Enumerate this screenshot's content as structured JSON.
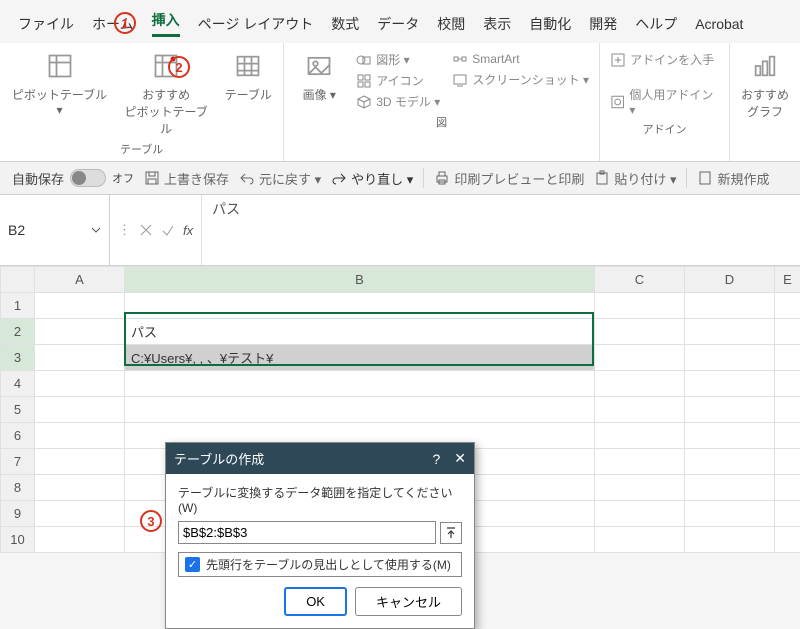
{
  "tabs": {
    "file": "ファイル",
    "home": "ホーム",
    "insert": "挿入",
    "page_layout": "ページ レイアウト",
    "formulas": "数式",
    "data": "データ",
    "review": "校閲",
    "view": "表示",
    "automate": "自動化",
    "developer": "開発",
    "help": "ヘルプ",
    "acrobat": "Acrobat"
  },
  "ribbon": {
    "tables_group": "テーブル",
    "pivot": "ピボットテーブル ▾",
    "recommended_pivot": "おすすめ\nピボットテーブル",
    "table": "テーブル",
    "illustrations_group": "図",
    "pictures": "画像 ▾",
    "shapes": "図形 ▾",
    "icons": "アイコン",
    "models3d": "3D モデル ▾",
    "smartart": "SmartArt",
    "screenshot": "スクリーンショット ▾",
    "addins_group": "アドイン",
    "get_addins": "アドインを入手",
    "my_addins": "個人用アドイン ▾",
    "charts": "おすすめ\nグラフ"
  },
  "qat": {
    "autosave": "自動保存",
    "autosave_state": "オフ",
    "save": "上書き保存",
    "undo": "元に戻す ▾",
    "redo": "やり直し ▾",
    "print_preview": "印刷プレビューと印刷",
    "paste": "貼り付け ▾",
    "new": "新規作成"
  },
  "namebox": "B2",
  "formula_bar": "パス",
  "grid": {
    "columns": [
      "A",
      "B",
      "C",
      "D",
      "E"
    ],
    "row_labels": [
      "1",
      "2",
      "3",
      "4",
      "5",
      "6",
      "7",
      "8",
      "9",
      "10"
    ],
    "b2": "パス",
    "b3": "C:¥Users¥,              ,  、¥テスト¥"
  },
  "dialog": {
    "title": "テーブルの作成",
    "help": "?",
    "close": "✕",
    "prompt": "テーブルに変換するデータ範囲を指定してください(W)",
    "range": "$B$2:$B$3",
    "header_check": "先頭行をテーブルの見出しとして使用する(M)",
    "ok": "OK",
    "cancel": "キャンセル"
  },
  "annotations": {
    "a1": "1",
    "a2": "2",
    "a3": "3"
  }
}
